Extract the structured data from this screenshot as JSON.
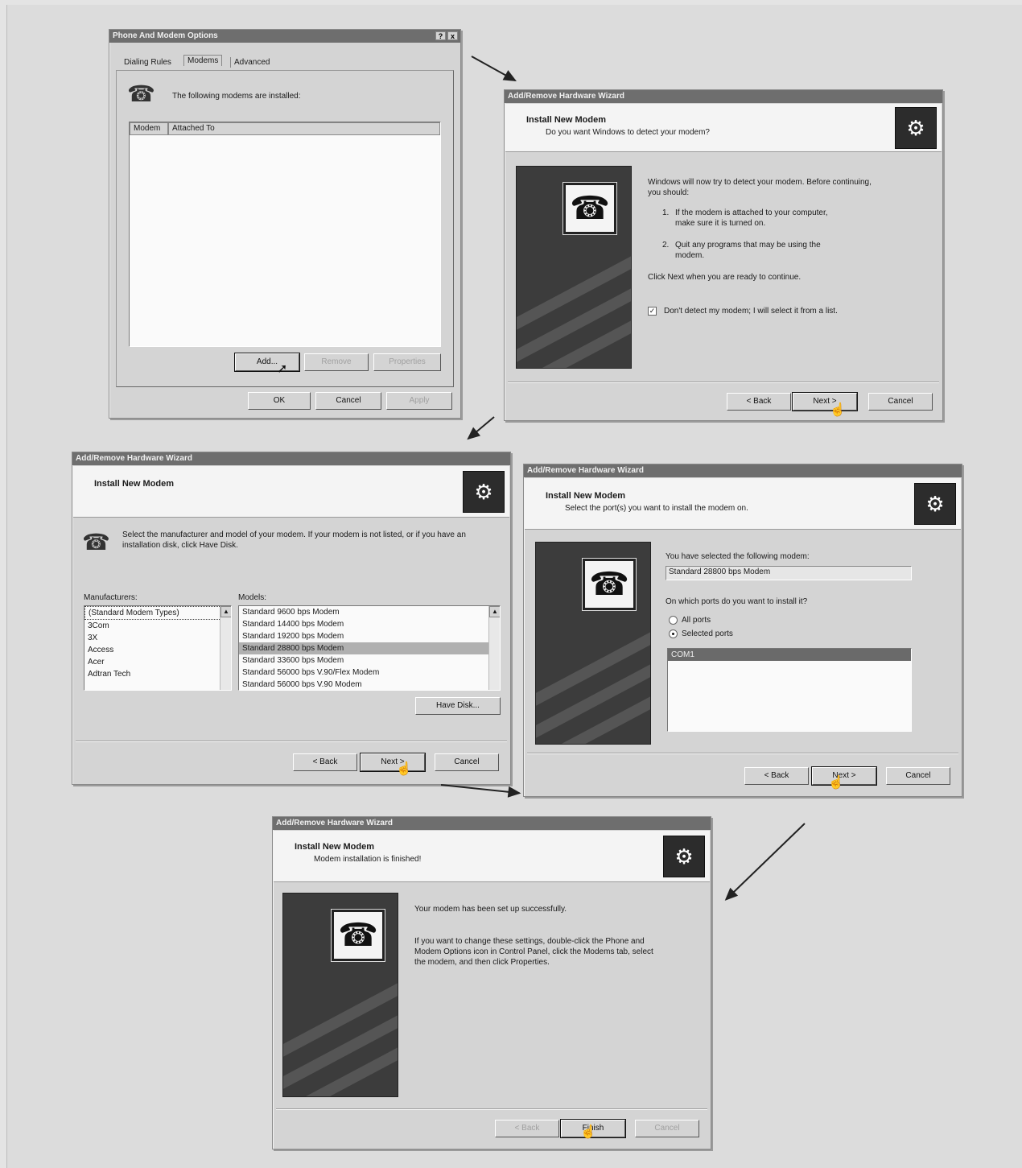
{
  "dialog1": {
    "title": "Phone And Modem Options",
    "title_buttons": [
      "?",
      "x"
    ],
    "tabs": [
      "Dialing Rules",
      "Modems",
      "Advanced"
    ],
    "intro": "The following modems are installed:",
    "columns": [
      "Modem",
      "Attached To"
    ],
    "list_buttons": {
      "add": "Add...",
      "remove": "Remove",
      "properties": "Properties"
    },
    "footer_buttons": {
      "ok": "OK",
      "cancel": "Cancel",
      "apply": "Apply"
    }
  },
  "dialog2": {
    "title": "Add/Remove Hardware Wizard",
    "header_title": "Install New Modem",
    "header_subtitle": "Do you want Windows to detect your modem?",
    "body_intro": "Windows will now try to detect your modem. Before continuing, you should:",
    "step1_num": "1.",
    "step1": "If the modem is attached to your computer, make sure it is turned on.",
    "step2_num": "2.",
    "step2": "Quit any programs that may be using the modem.",
    "continue_text": "Click Next when you are ready to continue.",
    "checkbox_label": "Don't detect my modem; I will select it from a list.",
    "buttons": {
      "back": "< Back",
      "next": "Next >",
      "cancel": "Cancel"
    }
  },
  "dialog3": {
    "title": "Add/Remove Hardware Wizard",
    "header_title": "Install New Modem",
    "instruction": "Select the manufacturer and model of your modem. If your modem is not listed, or if you have an installation disk, click Have Disk.",
    "manufacturers_label": "Manufacturers:",
    "manufacturers": [
      "(Standard Modem Types)",
      "3Com",
      "3X",
      "Access",
      "Acer",
      "Adtran Tech"
    ],
    "models_label": "Models:",
    "models": [
      "Standard 9600 bps Modem",
      "Standard 14400 bps Modem",
      "Standard 19200 bps Modem",
      "Standard 28800 bps Modem",
      "Standard 33600 bps Modem",
      "Standard 56000 bps V.90/Flex Modem",
      "Standard 56000 bps V.90 Modem"
    ],
    "selected_model_index": 3,
    "have_disk": "Have Disk...",
    "buttons": {
      "back": "< Back",
      "next": "Next >",
      "cancel": "Cancel"
    }
  },
  "dialog4": {
    "title": "Add/Remove Hardware Wizard",
    "header_title": "Install New Modem",
    "header_subtitle": "Select the port(s) you want to install the modem on.",
    "selected_label": "You have selected the following modem:",
    "selected_modem": "Standard 28800 bps Modem",
    "ports_question": "On which ports do you want to install it?",
    "radio_all": "All ports",
    "radio_selected": "Selected ports",
    "ports": [
      "COM1"
    ],
    "buttons": {
      "back": "< Back",
      "next": "Next >",
      "cancel": "Cancel"
    }
  },
  "dialog5": {
    "title": "Add/Remove Hardware Wizard",
    "header_title": "Install New Modem",
    "header_subtitle": "Modem installation is finished!",
    "success": "Your modem has been set up successfully.",
    "info": "If you want to change these settings, double-click the Phone and Modem Options icon in Control Panel, click the Modems tab, select the modem, and then click Properties.",
    "buttons": {
      "back": "< Back",
      "finish": "Finish",
      "cancel": "Cancel"
    }
  },
  "icons": {
    "hardware": "hardware-wizard-icon",
    "phone": "phone-icon",
    "modem": "modem-icon",
    "cursor": "mouse-cursor-icon"
  },
  "colors": {
    "dialog_bg": "#d4d4d4",
    "titlebar": "#6e6e6e",
    "header_bg": "#f4f4f4",
    "side_image": "#3c3c3c"
  }
}
